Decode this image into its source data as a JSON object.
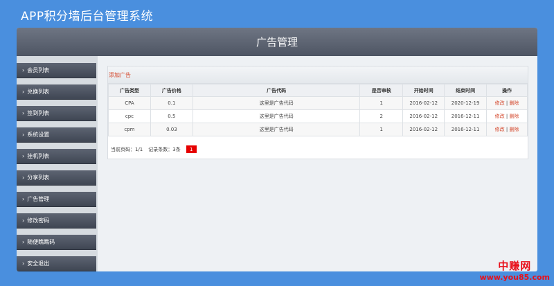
{
  "app": {
    "title": "APP积分墙后台管理系统"
  },
  "header": {
    "title": "广告管理"
  },
  "sidebar": {
    "items": [
      {
        "label": "会员列表"
      },
      {
        "label": "兑换列表"
      },
      {
        "label": "签到列表"
      },
      {
        "label": "系统设置"
      },
      {
        "label": "挂机列表"
      },
      {
        "label": "分享列表"
      },
      {
        "label": "广告管理"
      },
      {
        "label": "修改密码"
      },
      {
        "label": "随便瞧瞧码"
      },
      {
        "label": "安全退出"
      }
    ],
    "chevron_icon": "chevron-right-icon"
  },
  "main": {
    "add_label": "添加广告",
    "columns": [
      "广告类型",
      "广告价格",
      "广告代码",
      "是否审核",
      "开始时间",
      "结束时间",
      "操作"
    ],
    "rows": [
      {
        "type": "CPA",
        "price": "0.1",
        "code": "这里是广告代码",
        "audit": "1",
        "start": "2016-02-12",
        "end": "2020-12-19",
        "edit": "修改",
        "sep": "|",
        "delete": "删除"
      },
      {
        "type": "cpc",
        "price": "0.5",
        "code": "这里是广告代码",
        "audit": "2",
        "start": "2016-02-12",
        "end": "2016-12-11",
        "edit": "修改",
        "sep": "|",
        "delete": "删除"
      },
      {
        "type": "cpm",
        "price": "0.03",
        "code": "这里是广告代码",
        "audit": "1",
        "start": "2016-02-12",
        "end": "2016-12-11",
        "edit": "修改",
        "sep": "|",
        "delete": "删除"
      }
    ],
    "pager": {
      "current": "当前页码：1/1",
      "count": "记录条数：3条",
      "page": "1"
    }
  },
  "watermark": {
    "top": "中赚网",
    "bottom": "www.you85.com"
  },
  "colors": {
    "background": "#4a8fde",
    "accent": "#d4472b",
    "page_active": "#e60000"
  }
}
